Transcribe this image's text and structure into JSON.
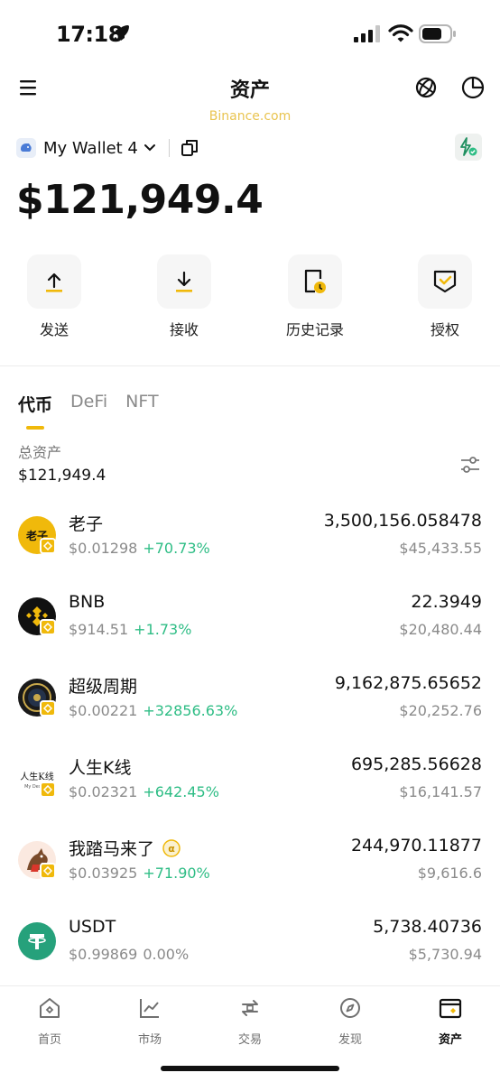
{
  "status": {
    "time": "17:18"
  },
  "header": {
    "title": "资产",
    "watermark": "Binance.com"
  },
  "wallet": {
    "name": "My Wallet 4",
    "balance": "$121,949.4"
  },
  "actions": [
    {
      "label": "发送",
      "icon": "send-arrow-up-icon"
    },
    {
      "label": "接收",
      "icon": "receive-arrow-down-icon"
    },
    {
      "label": "历史记录",
      "icon": "history-clock-icon"
    },
    {
      "label": "授权",
      "icon": "authorization-check-icon"
    }
  ],
  "tabs": [
    {
      "label": "代币",
      "active": true
    },
    {
      "label": "DeFi",
      "active": false
    },
    {
      "label": "NFT",
      "active": false
    }
  ],
  "total": {
    "label": "总资产",
    "value": "$121,949.4"
  },
  "assets": [
    {
      "name": "老子",
      "logo_text": "老子",
      "price": "$0.01298",
      "change": "+70.73%",
      "amount": "3,500,156.058478",
      "value": "$45,433.55"
    },
    {
      "name": "BNB",
      "price": "$914.51",
      "change": "+1.73%",
      "amount": "22.3949",
      "value": "$20,480.44"
    },
    {
      "name": "超级周期",
      "price": "$0.00221",
      "change": "+32856.63%",
      "amount": "9,162,875.65652",
      "value": "$20,252.76"
    },
    {
      "name": "人生K线",
      "logo_text": "人生K线",
      "logo_subtext": "My Destiny",
      "price": "$0.02321",
      "change": "+642.45%",
      "amount": "695,285.56628",
      "value": "$16,141.57"
    },
    {
      "name": "我踏马来了",
      "price": "$0.03925",
      "change": "+71.90%",
      "amount": "244,970.11877",
      "value": "$9,616.6"
    },
    {
      "name": "USDT",
      "price": "$0.99869",
      "change": "0.00%",
      "amount": "5,738.40736",
      "value": "$5,730.94"
    }
  ],
  "bottom_nav": [
    {
      "label": "首页",
      "icon": "home-icon",
      "active": false
    },
    {
      "label": "市场",
      "icon": "market-chart-icon",
      "active": false
    },
    {
      "label": "交易",
      "icon": "trade-swap-icon",
      "active": false
    },
    {
      "label": "发现",
      "icon": "discover-compass-icon",
      "active": false
    },
    {
      "label": "资产",
      "icon": "wallet-icon",
      "active": true
    }
  ],
  "colors": {
    "accent": "#f0b90b",
    "positive": "#2ebd85",
    "muted": "#8a8a8a"
  }
}
